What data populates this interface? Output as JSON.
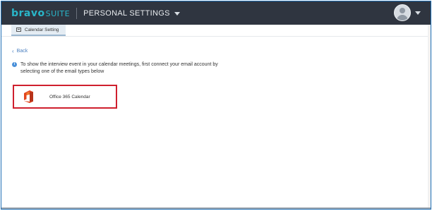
{
  "header": {
    "logo_bravo": "bravo",
    "logo_suite": "SUITE",
    "section_title": "PERSONAL SETTINGS",
    "user_menu_icon": "user-avatar-icon"
  },
  "tabs": [
    {
      "label": "Calendar Setting",
      "icon": "calendar-icon",
      "active": true
    }
  ],
  "content": {
    "back_label": "Back",
    "info_text": "To show the interview event in your calendar meetings, first connect your email account by selecting one of the email types below",
    "options": [
      {
        "label": "Office 365 Calendar",
        "icon": "office-365-icon",
        "selected": true
      }
    ]
  },
  "colors": {
    "topbar": "#2f3540",
    "brand": "#29b6c9",
    "link": "#4a7fc0",
    "selection_border": "#cf1f2e"
  }
}
